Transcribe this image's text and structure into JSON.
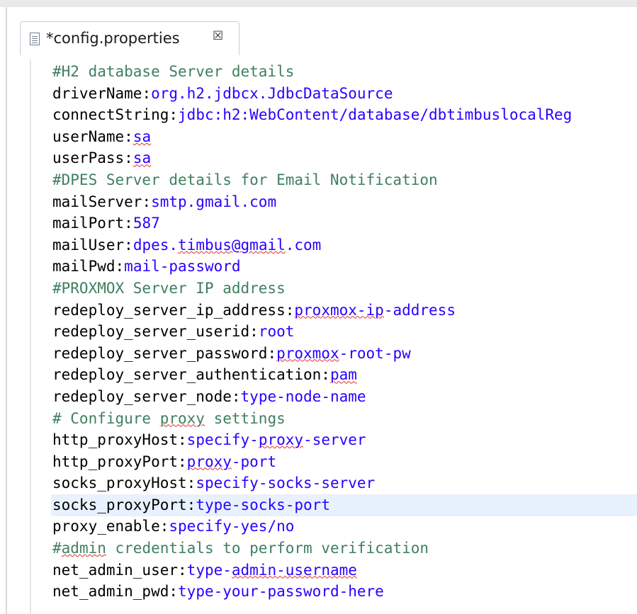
{
  "tab": {
    "title": "*config.properties",
    "close_glyph": "☒",
    "icon": "properties-file-icon"
  },
  "editor": {
    "lines": [
      {
        "type": "comment",
        "text": "#H2 database Server details"
      },
      {
        "type": "property",
        "key": "driverName",
        "value": "org.h2.jdbcx.JdbcDataSource"
      },
      {
        "type": "property",
        "key": "connectString",
        "value": "jdbc:h2:WebContent/database/dbtimbuslocalReg"
      },
      {
        "type": "property",
        "key": "userName",
        "value": "sa",
        "squiggle": true
      },
      {
        "type": "property",
        "key": "userPass",
        "value": "sa",
        "squiggle": true
      },
      {
        "type": "comment",
        "text": "#DPES Server details for Email Notification"
      },
      {
        "type": "property",
        "key": "mailServer",
        "value": "smtp.gmail.com"
      },
      {
        "type": "property",
        "key": "mailPort",
        "value": "587"
      },
      {
        "type": "property",
        "key": "mailUser",
        "value": "dpes.timbus@gmail.com",
        "squiggle_part": "timbus@gmail"
      },
      {
        "type": "property",
        "key": "mailPwd",
        "value": "mail-password"
      },
      {
        "type": "comment",
        "text": "#PROXMOX Server IP address"
      },
      {
        "type": "property",
        "key": "redeploy_server_ip_address",
        "value": "proxmox-ip-address",
        "squiggle_part": "proxmox-ip"
      },
      {
        "type": "property",
        "key": "redeploy_server_userid",
        "value": "root"
      },
      {
        "type": "property",
        "key": "redeploy_server_password",
        "value": "proxmox-root-pw",
        "squiggle_part": "proxmox"
      },
      {
        "type": "property",
        "key": "redeploy_server_authentication",
        "value": "pam",
        "squiggle": true
      },
      {
        "type": "property",
        "key": "redeploy_server_node",
        "value": "type-node-name"
      },
      {
        "type": "comment",
        "text": "# Configure proxy settings",
        "squiggle_part": "proxy"
      },
      {
        "type": "property",
        "key": "http_proxyHost",
        "value": "specify-proxy-server",
        "squiggle_part": "proxy"
      },
      {
        "type": "property",
        "key": "http_proxyPort",
        "value": "proxy-port",
        "squiggle_part": "proxy"
      },
      {
        "type": "property",
        "key": "socks_proxyHost",
        "value": "specify-socks-server"
      },
      {
        "type": "property",
        "key": "socks_proxyPort",
        "value": "type-socks-port",
        "current": true
      },
      {
        "type": "property",
        "key": "proxy_enable",
        "value": "specify-yes/no"
      },
      {
        "type": "comment",
        "text": "#admin credentials to perform verification",
        "squiggle_part": "admin"
      },
      {
        "type": "property",
        "key": "net_admin_user",
        "value": "type-admin-username",
        "squiggle_part": "admin-username"
      },
      {
        "type": "property",
        "key": "net_admin_pwd",
        "value": "type-your-password-here"
      }
    ]
  },
  "colors": {
    "comment": "#3f7f5f",
    "key": "#000000",
    "value": "#2a00ff",
    "current_line": "#e8f2fe",
    "spelling_squiggle": "#e03030"
  }
}
